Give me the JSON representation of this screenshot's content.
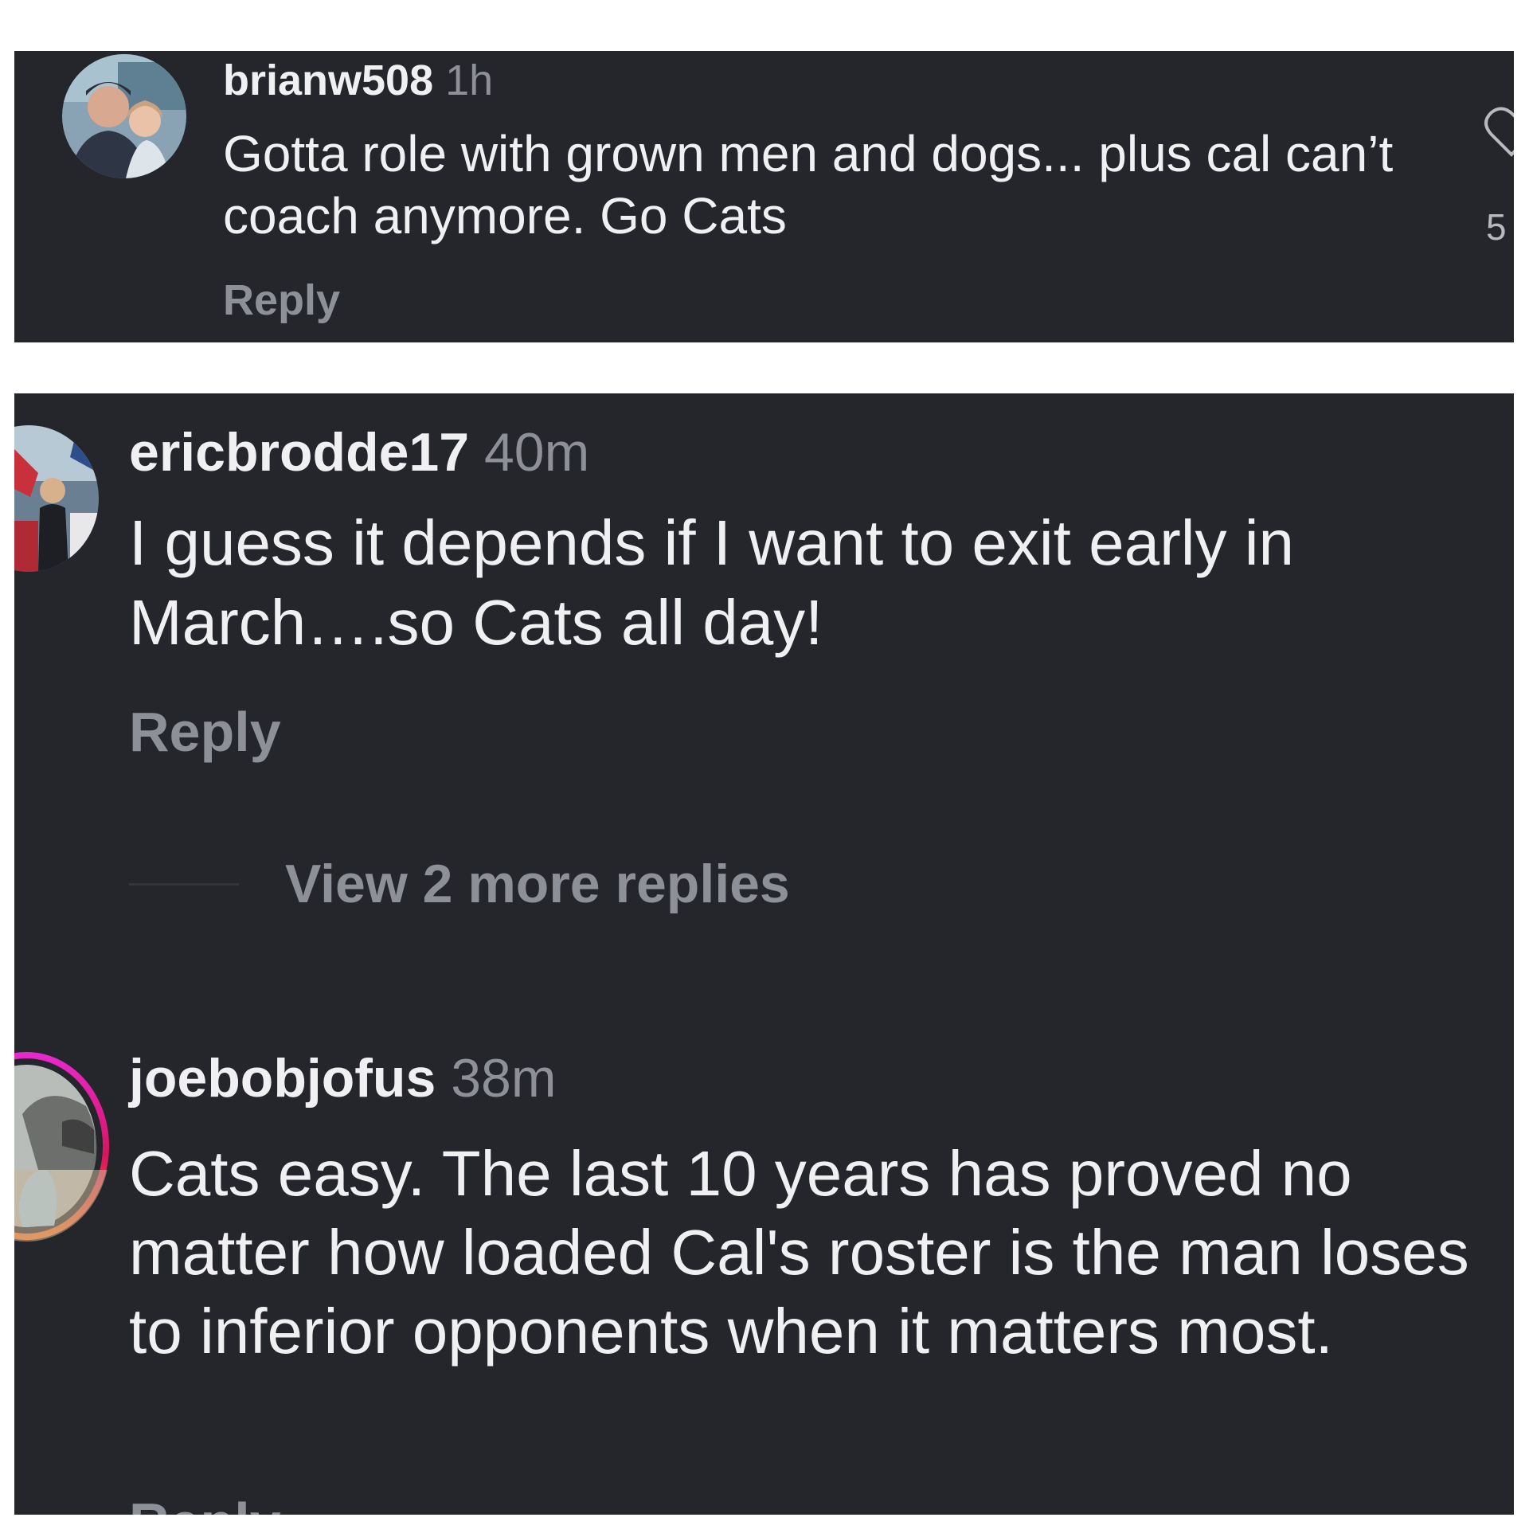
{
  "comments": [
    {
      "username": "brianw508",
      "time": "1h",
      "text": "Gotta role with grown men and dogs... plus cal can’t coach anymore.  Go Cats",
      "reply_label": "Reply",
      "like_count": "5"
    },
    {
      "username": "ericbrodde17",
      "time": "40m",
      "text": "I guess it depends if I want to exit early in March….so Cats all day!",
      "reply_label": "Reply",
      "view_more_label": "View 2 more replies"
    },
    {
      "username": "joebobjofus",
      "time": "38m",
      "text": "Cats easy. The last 10 years has proved no matter how loaded Cal's roster is the man loses to inferior opponents when it matters most.",
      "reply_label": "Reply"
    }
  ],
  "colors": {
    "panel_bg": "#25262b",
    "text_primary": "#f0f0f2",
    "text_secondary": "#8e9097",
    "story_ring_start": "#e62ad0",
    "story_ring_end": "#ff7a1a"
  }
}
